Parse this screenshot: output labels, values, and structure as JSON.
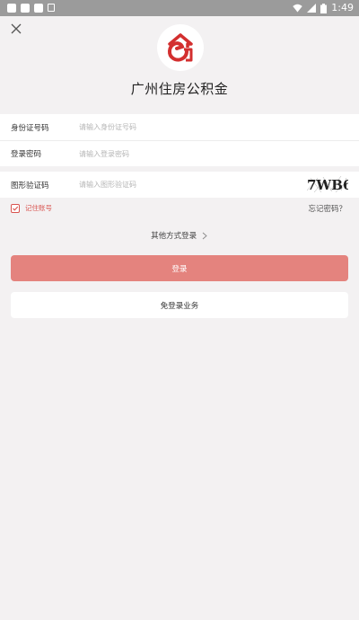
{
  "status_bar": {
    "time": "1:49",
    "left_icons": [
      "notification-icon",
      "notification-icon",
      "notification-icon",
      "notification-icon"
    ],
    "right_icons": [
      "wifi-icon",
      "signal-icon",
      "battery-icon"
    ]
  },
  "header": {
    "title": "广州住房公积金",
    "brand_color": "#d32f2f"
  },
  "form": {
    "id_label": "身份证号码",
    "id_placeholder": "请输入身份证号码",
    "password_label": "登录密码",
    "password_placeholder": "请输入登录密码",
    "captcha_label": "图形验证码",
    "captcha_placeholder": "请输入图形验证码",
    "captcha_text": "7WB6"
  },
  "options": {
    "remember_label": "记住账号",
    "remember_checked": true,
    "forgot_label": "忘记密码？"
  },
  "other_login": "其他方式登录",
  "buttons": {
    "login": "登录",
    "no_login": "免登录业务",
    "login_color": "#e4837e"
  }
}
